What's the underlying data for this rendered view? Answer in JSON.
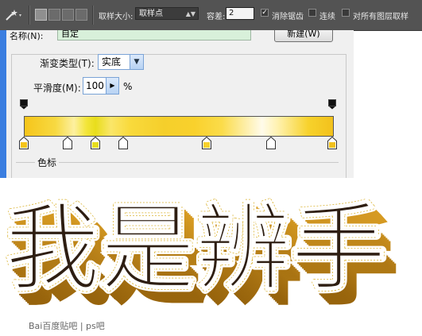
{
  "options_bar": {
    "tool_icon": "magic-wand-icon",
    "sample_size_label": "取样大小:",
    "sample_size_value": "取样点",
    "tolerance_label": "容差:",
    "tolerance_value": "2",
    "antialias_label": "消除锯齿",
    "antialias_checked": true,
    "contiguous_label": "连续",
    "contiguous_checked": false,
    "all_layers_label": "对所有图层取样",
    "all_layers_checked": false
  },
  "gradient_editor": {
    "name_label": "名称(N):",
    "name_value": "自定",
    "new_button": "新建(W)",
    "gradient_type_label": "渐变类型(T):",
    "gradient_type_value": "实底",
    "smoothness_label": "平滑度(M):",
    "smoothness_value": "100",
    "smoothness_unit": "%",
    "color_stops_section": "色标",
    "color_stops": [
      {
        "location_pct": 0,
        "color": "#f6c51a"
      },
      {
        "location_pct": 14,
        "color": "#ffffff"
      },
      {
        "location_pct": 23,
        "color": "#e8dd1c"
      },
      {
        "location_pct": 32,
        "color": "#ffffff"
      },
      {
        "location_pct": 59,
        "color": "#f9d12c"
      },
      {
        "location_pct": 80,
        "color": "#ffffff"
      },
      {
        "location_pct": 100,
        "color": "#f2c11c"
      }
    ],
    "opacity_stops": [
      0,
      100
    ]
  },
  "artwork": {
    "text": "我是辨手",
    "face_color": "#2e1e12",
    "outline_color": "#ffffff",
    "extrude_color": "#b8790b"
  },
  "watermark": "Bai百度贴吧 | ps吧"
}
